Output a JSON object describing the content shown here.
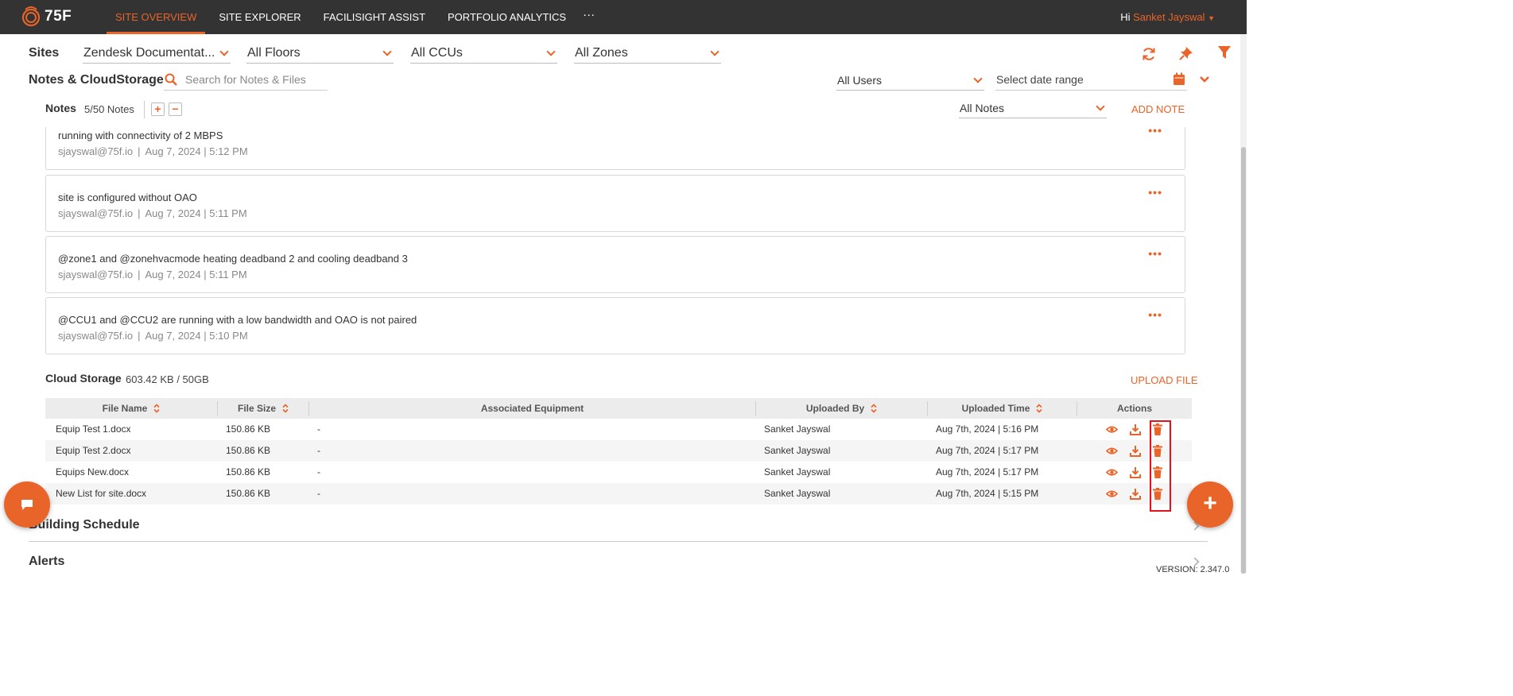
{
  "header": {
    "logo_text": "75F",
    "nav": [
      {
        "label": "SITE OVERVIEW",
        "active": true
      },
      {
        "label": "SITE EXPLORER",
        "active": false
      },
      {
        "label": "FACILISIGHT ASSIST",
        "active": false
      },
      {
        "label": "PORTFOLIO ANALYTICS",
        "active": false
      }
    ],
    "more_label": "···",
    "greeting": "Hi",
    "user_name": "Sanket Jayswal"
  },
  "filters": {
    "sites_label": "Sites",
    "site": "Zendesk Documentat...",
    "floors": "All Floors",
    "ccus": "All CCUs",
    "zones": "All Zones"
  },
  "notes_storage": {
    "title": "Notes & CloudStorage",
    "search_placeholder": "Search for Notes & Files",
    "users_filter": "All Users",
    "date_placeholder": "Select date range"
  },
  "notes": {
    "label": "Notes",
    "count": "5/50 Notes",
    "plus": "+",
    "minus": "−",
    "type_filter": "All Notes",
    "add_label": "ADD NOTE",
    "items": [
      {
        "text": "running with connectivity of 2 MBPS",
        "author": "sjayswal@75f.io",
        "sep": "|",
        "time": "Aug 7, 2024 | 5:12 PM"
      },
      {
        "text": "site is configured without OAO",
        "author": "sjayswal@75f.io",
        "sep": "|",
        "time": "Aug 7, 2024 | 5:11 PM"
      },
      {
        "text": "@zone1 and @zonehvacmode heating deadband 2 and cooling deadband 3",
        "author": "sjayswal@75f.io",
        "sep": "|",
        "time": "Aug 7, 2024 | 5:11 PM"
      },
      {
        "text": "@CCU1 and @CCU2 are running with a low bandwidth and OAO is not paired",
        "author": "sjayswal@75f.io",
        "sep": "|",
        "time": "Aug 7, 2024 | 5:10 PM"
      }
    ],
    "more": "•••"
  },
  "cloud_storage": {
    "label": "Cloud Storage",
    "usage": "603.42 KB / 50GB",
    "upload_label": "UPLOAD FILE",
    "columns": [
      "File Name",
      "File Size",
      "Associated Equipment",
      "Uploaded By",
      "Uploaded Time",
      "Actions"
    ],
    "rows": [
      {
        "name": "Equip Test 1.docx",
        "size": "150.86 KB",
        "equipment": "-",
        "by": "Sanket Jayswal",
        "time": "Aug 7th, 2024 | 5:16 PM"
      },
      {
        "name": "Equip Test 2.docx",
        "size": "150.86 KB",
        "equipment": "-",
        "by": "Sanket Jayswal",
        "time": "Aug 7th, 2024 | 5:17 PM"
      },
      {
        "name": "Equips New.docx",
        "size": "150.86 KB",
        "equipment": "-",
        "by": "Sanket Jayswal",
        "time": "Aug 7th, 2024 | 5:17 PM"
      },
      {
        "name": "New List for site.docx",
        "size": "150.86 KB",
        "equipment": "-",
        "by": "Sanket Jayswal",
        "time": "Aug 7th, 2024 | 5:15 PM"
      }
    ]
  },
  "sections": {
    "building_schedule": "Building Schedule",
    "alerts": "Alerts"
  },
  "fab_add": "+",
  "version": "VERSION: 2.347.0",
  "colors": {
    "accent": "#E86429",
    "topbar": "#333333",
    "highlight": "#e0141e"
  }
}
